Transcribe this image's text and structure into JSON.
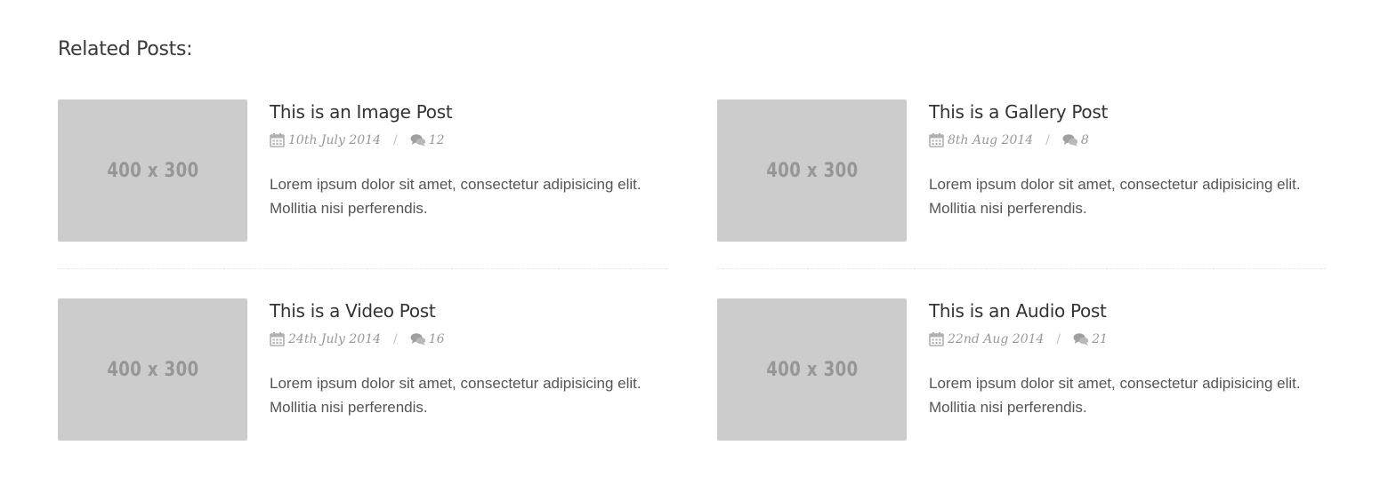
{
  "section": {
    "title": "Related Posts:"
  },
  "posts": [
    {
      "thumb_label": "400 x 300",
      "title": "This is an Image Post",
      "date": "10th July 2014",
      "separator": "/",
      "comments": "12",
      "excerpt": "Lorem ipsum dolor sit amet, consectetur adipisicing elit. Mollitia nisi perferendis."
    },
    {
      "thumb_label": "400 x 300",
      "title": "This is a Gallery Post",
      "date": "8th Aug 2014",
      "separator": "/",
      "comments": "8",
      "excerpt": "Lorem ipsum dolor sit amet, consectetur adipisicing elit. Mollitia nisi perferendis."
    },
    {
      "thumb_label": "400 x 300",
      "title": "This is a Video Post",
      "date": "24th July 2014",
      "separator": "/",
      "comments": "16",
      "excerpt": "Lorem ipsum dolor sit amet, consectetur adipisicing elit. Mollitia nisi perferendis."
    },
    {
      "thumb_label": "400 x 300",
      "title": "This is an Audio Post",
      "date": "22nd Aug 2014",
      "separator": "/",
      "comments": "21",
      "excerpt": "Lorem ipsum dolor sit amet, consectetur adipisicing elit. Mollitia nisi perferendis."
    }
  ],
  "icons": {
    "date": "calendar-icon",
    "comments": "comments-icon"
  },
  "colors": {
    "thumb_bg": "#cccccc",
    "meta": "#999999",
    "title": "#333333"
  }
}
